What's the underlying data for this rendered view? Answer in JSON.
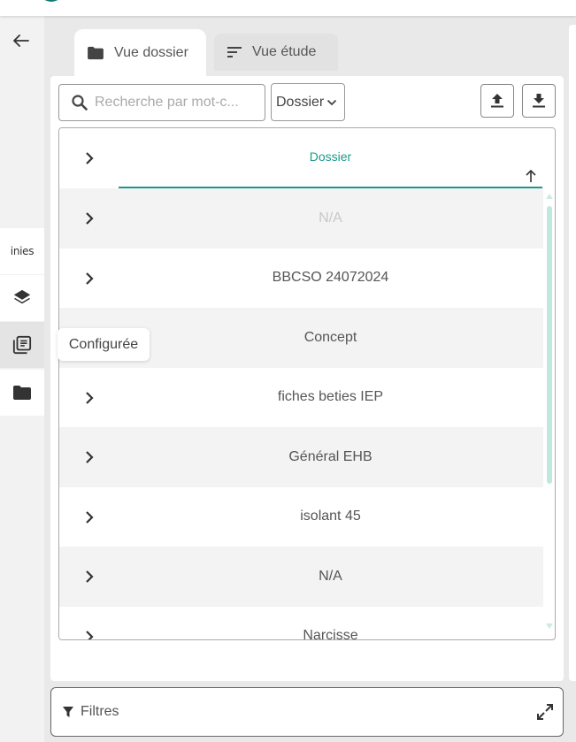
{
  "tabs": [
    {
      "label": "Vue dossier",
      "icon": "folder-icon",
      "active": true
    },
    {
      "label": "Vue étude",
      "icon": "sort-icon",
      "active": false
    }
  ],
  "search": {
    "placeholder": "Recherche par mot-c..."
  },
  "select": {
    "value": "Dossier"
  },
  "rail": {
    "inies_label": "inies",
    "tooltip": "Configurée"
  },
  "table": {
    "column_header": "Dossier",
    "rows": [
      {
        "value": "N/A"
      },
      {
        "value": "BBCSO 24072024"
      },
      {
        "value": "Concept"
      },
      {
        "value": "fiches beties IEP"
      },
      {
        "value": "Général EHB"
      },
      {
        "value": "isolant 45"
      },
      {
        "value": "N/A"
      },
      {
        "value": "Narcisse"
      }
    ]
  },
  "filters": {
    "label": "Filtres"
  },
  "colors": {
    "accent": "#1a9a8a",
    "brand": "#0e7a75",
    "scrollbar": "#bfe8df"
  }
}
